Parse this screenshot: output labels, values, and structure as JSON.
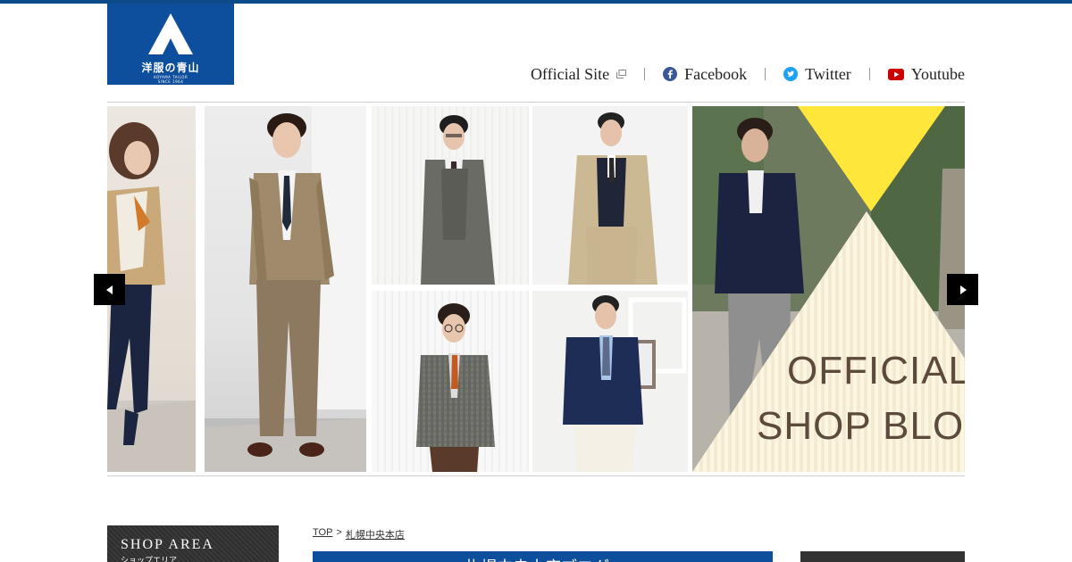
{
  "logo": {
    "main": "洋服の青山",
    "sub1": "AOYAMA TAILOR",
    "sub2": "SINCE 1964"
  },
  "nav": {
    "official_site": "Official Site",
    "facebook": "Facebook",
    "twitter": "Twitter",
    "youtube": "Youtube"
  },
  "icons": {
    "logo": "mountain-logo-icon",
    "official_site": "external-window-icon",
    "facebook": "facebook-icon",
    "twitter": "twitter-icon",
    "youtube": "youtube-icon",
    "prev": "arrow-left-icon",
    "next": "arrow-right-icon"
  },
  "colors": {
    "brand_blue": "#0d4f9c",
    "facebook": "#3b5998",
    "twitter": "#1da1f2",
    "youtube": "#cc0000",
    "banner_yellow": "#ffe63b"
  },
  "slider": {
    "banner_line1": "OFFICIAL",
    "banner_line2": "SHOP BLOG"
  },
  "sidebar": {
    "title": "SHOP AREA",
    "subtitle": "ショップエリア"
  },
  "breadcrumb": {
    "top": "TOP",
    "separator": ">",
    "current": "札幌中央本店"
  },
  "main": {
    "heading": "札幌中央本店ブログ"
  }
}
